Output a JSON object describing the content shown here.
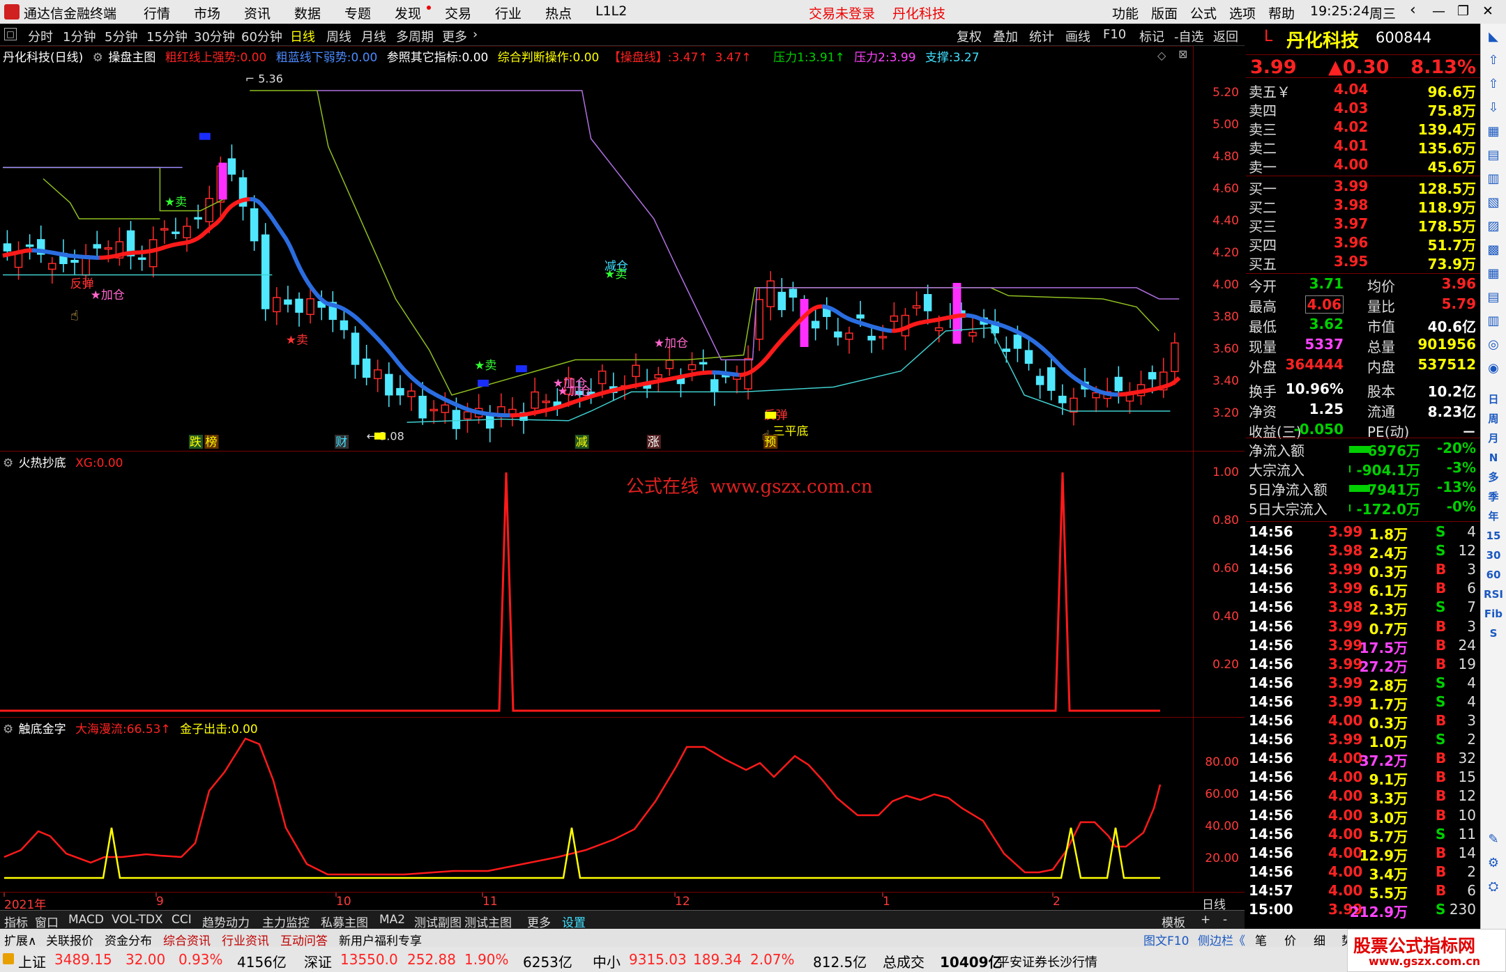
{
  "titlebar": {
    "app": "通达信金融终端",
    "menu": [
      "行情",
      "市场",
      "资讯",
      "数据",
      "专题",
      "发现",
      "交易",
      "行业",
      "热点",
      "L1L2"
    ],
    "login": "交易未登录",
    "stock": "丹化科技",
    "right": [
      "功能",
      "版面",
      "公式",
      "选项",
      "帮助"
    ],
    "time": "19:25:24",
    "weekday": "周三"
  },
  "periods": [
    "分时",
    "1分钟",
    "5分钟",
    "15分钟",
    "30分钟",
    "60分钟",
    "日线",
    "周线",
    "月线",
    "多周期",
    "更多"
  ],
  "toolbar": [
    "复权",
    "叠加",
    "统计",
    "画线",
    "F10",
    "标记",
    "-自选",
    "返回"
  ],
  "main": {
    "info": {
      "title": "丹化科技(日线)",
      "template": "操盘主图",
      "red_label": "粗红线上强势:",
      "red_val": "0.00",
      "blue_label": "粗蓝线下弱势:",
      "blue_val": "0.00",
      "ref_label": "参照其它指标:",
      "ref_val": "0.00",
      "judge_label": "综合判断操作:",
      "judge_val": "0.00",
      "cp_label": "【操盘线】:",
      "cp_val": "3.47↑",
      "cp_val2": "3.47↑",
      "p1_label": "压力1:",
      "p1_val": "3.91↑",
      "p2_label": "压力2:",
      "p2_val": "3.99",
      "sup_label": "支撑:",
      "sup_val": "3.27"
    },
    "axis": [
      "5.20",
      "5.00",
      "4.80",
      "4.60",
      "4.40",
      "4.20",
      "4.00",
      "3.80",
      "3.60",
      "3.40",
      "3.20"
    ],
    "high_label": "5.36",
    "low_label": "3.08",
    "signals": [
      {
        "text": "★卖",
        "color": "#33ff33"
      },
      {
        "text": "★加仓",
        "color": "#ff66cc"
      },
      {
        "text": "反弹",
        "color": "#ff3333"
      },
      {
        "text": "★卖",
        "color": "#ff3333"
      },
      {
        "text": "★卖",
        "color": "#33ff33"
      },
      {
        "text": "★加仓",
        "color": "#ff66cc"
      },
      {
        "text": "★加仓",
        "color": "#ff66cc"
      },
      {
        "text": "减仓",
        "color": "#40e0ff"
      },
      {
        "text": "★卖",
        "color": "#33ff33"
      },
      {
        "text": "★加仓",
        "color": "#ff66cc"
      },
      {
        "text": "反弹",
        "color": "#ff3333"
      },
      {
        "text": "三平底",
        "color": "#ffff00"
      }
    ],
    "bottom_tags": [
      {
        "text": "跌",
        "bg": "#225522",
        "fg": "#ffff00"
      },
      {
        "text": "榜",
        "bg": "#663300",
        "fg": "#ffff00"
      },
      {
        "text": "财",
        "bg": "#333333",
        "fg": "#40e0ff"
      },
      {
        "text": "减",
        "bg": "#225522",
        "fg": "#ffff00"
      },
      {
        "text": "涨",
        "bg": "#552222",
        "fg": "#ffffff"
      },
      {
        "text": "预",
        "bg": "#663300",
        "fg": "#ffff00"
      }
    ]
  },
  "pane2": {
    "title": "火热抄底",
    "xg_label": "XG:",
    "xg_val": "0.00",
    "watermark": "公式在线  www.gszx.com.cn",
    "axis": [
      "1.00",
      "0.80",
      "0.60",
      "0.40",
      "0.20"
    ]
  },
  "pane3": {
    "title": "触底金字",
    "s1_label": "大海漫流:",
    "s1_val": "66.53↑",
    "s2_label": "金子出击:",
    "s2_val": "0.00",
    "axis": [
      "80.00",
      "60.00",
      "40.00",
      "20.00"
    ]
  },
  "xaxis": {
    "labels": [
      "2021年",
      "9",
      "10",
      "11",
      "12",
      "1",
      "2"
    ],
    "right": "日线"
  },
  "quote": {
    "header_prefix": "L",
    "name": "丹化科技",
    "code": "600844",
    "price": "3.99",
    "change": "▲0.30",
    "pct": "8.13%",
    "asks": [
      {
        "label": "卖五￥",
        "price": "4.04",
        "vol": "96.6万"
      },
      {
        "label": "卖四",
        "price": "4.03",
        "vol": "75.8万"
      },
      {
        "label": "卖三",
        "price": "4.02",
        "vol": "139.4万"
      },
      {
        "label": "卖二",
        "price": "4.01",
        "vol": "135.6万"
      },
      {
        "label": "卖一",
        "price": "4.00",
        "vol": "45.6万"
      }
    ],
    "bids": [
      {
        "label": "买一",
        "price": "3.99",
        "vol": "128.5万"
      },
      {
        "label": "买二",
        "price": "3.98",
        "vol": "118.9万"
      },
      {
        "label": "买三",
        "price": "3.97",
        "vol": "178.5万"
      },
      {
        "label": "买四",
        "price": "3.96",
        "vol": "51.7万"
      },
      {
        "label": "买五",
        "price": "3.95",
        "vol": "73.9万"
      }
    ],
    "stats": [
      [
        "今开",
        "3.71",
        "均价",
        "3.96"
      ],
      [
        "最高",
        "4.06",
        "量比",
        "5.79"
      ],
      [
        "最低",
        "3.62",
        "市值",
        "40.6亿"
      ],
      [
        "现量",
        "5337",
        "总量",
        "901956"
      ],
      [
        "外盘",
        "364444",
        "内盘",
        "537512"
      ],
      [
        "换手",
        "10.96%",
        "股本",
        "10.2亿"
      ],
      [
        "净资",
        "1.25",
        "流通",
        "8.23亿"
      ],
      [
        "收益(三)",
        "-0.050",
        "PE(动)",
        "－"
      ]
    ],
    "flows": [
      [
        "净流入额",
        "-6976万",
        "-20%"
      ],
      [
        "大宗流入",
        "-904.1万",
        "-3%"
      ],
      [
        "5日净流入额",
        "-7941万",
        "-13%"
      ],
      [
        "5日大宗流入",
        "-172.0万",
        "-0%"
      ]
    ],
    "ticks": [
      [
        "14:56",
        "3.99",
        "1.8万",
        "S",
        "4"
      ],
      [
        "14:56",
        "3.98",
        "2.4万",
        "S",
        "12"
      ],
      [
        "14:56",
        "3.99",
        "0.3万",
        "B",
        "3"
      ],
      [
        "14:56",
        "3.99",
        "6.1万",
        "B",
        "6"
      ],
      [
        "14:56",
        "3.98",
        "2.3万",
        "S",
        "7"
      ],
      [
        "14:56",
        "3.99",
        "0.7万",
        "B",
        "3"
      ],
      [
        "14:56",
        "3.99",
        "17.5万",
        "B",
        "24"
      ],
      [
        "14:56",
        "3.99",
        "27.2万",
        "B",
        "19"
      ],
      [
        "14:56",
        "3.99",
        "2.8万",
        "S",
        "4"
      ],
      [
        "14:56",
        "3.99",
        "1.7万",
        "S",
        "4"
      ],
      [
        "14:56",
        "4.00",
        "0.3万",
        "B",
        "3"
      ],
      [
        "14:56",
        "3.99",
        "1.0万",
        "S",
        "2"
      ],
      [
        "14:56",
        "4.00",
        "37.2万",
        "B",
        "32"
      ],
      [
        "14:56",
        "4.00",
        "9.1万",
        "B",
        "15"
      ],
      [
        "14:56",
        "4.00",
        "3.3万",
        "B",
        "12"
      ],
      [
        "14:56",
        "4.00",
        "3.0万",
        "B",
        "10"
      ],
      [
        "14:56",
        "4.00",
        "5.7万",
        "S",
        "11"
      ],
      [
        "14:56",
        "4.00",
        "12.9万",
        "B",
        "14"
      ],
      [
        "14:56",
        "4.00",
        "3.4万",
        "B",
        "2"
      ],
      [
        "14:57",
        "4.00",
        "5.5万",
        "B",
        "6"
      ],
      [
        "15:00",
        "3.99",
        "212.9万",
        "S",
        "230"
      ]
    ]
  },
  "sidebar": [
    "日",
    "周",
    "月",
    "N",
    "多",
    "季",
    "年",
    "15",
    "30",
    "60",
    "RSI",
    "Fib",
    "S"
  ],
  "tabs1": [
    "指标",
    "窗口",
    "MACD",
    "VOL-TDX",
    "CCI",
    "趋势动力",
    "主力监控",
    "私募主图",
    "MA2",
    "测试副图",
    "测试主图",
    "更多",
    "设置",
    "模板",
    "+",
    "-"
  ],
  "tabs2": [
    "扩展∧",
    "关联报价",
    "资金分布",
    "综合资讯",
    "行业资讯",
    "互动问答",
    "新用户福利专享"
  ],
  "tabs2_right": [
    "图文F10",
    "侧边栏《",
    "笔",
    "价",
    "细",
    "势"
  ],
  "status": {
    "sh_label": "上证",
    "sh": "3489.15",
    "sh_chg": "32.00",
    "sh_pct": "0.93%",
    "sh_amt": "4156亿",
    "sz_label": "深证",
    "sz": "13550.0",
    "sz_chg": "252.88",
    "sz_pct": "1.90%",
    "sz_amt": "6253亿",
    "zx_label": "中小",
    "zx": "9315.03",
    "zx_chg": "189.34",
    "zx_pct": "2.07%",
    "zx_amt": "812.5亿",
    "total_label": "总成交",
    "total": "10409亿",
    "broker": "平安证券长沙行情",
    "brand": "股票公式指标网",
    "brand_url": "www.gszx.com.cn"
  },
  "colors": {
    "up": "#ff2222",
    "down": "#40e0ff",
    "ma_blue": "#2a6de0",
    "ma_red": "#ff1a1a",
    "resist1": "#8fbf20",
    "resist2": "#b070e0",
    "support": "#40d0d0"
  }
}
